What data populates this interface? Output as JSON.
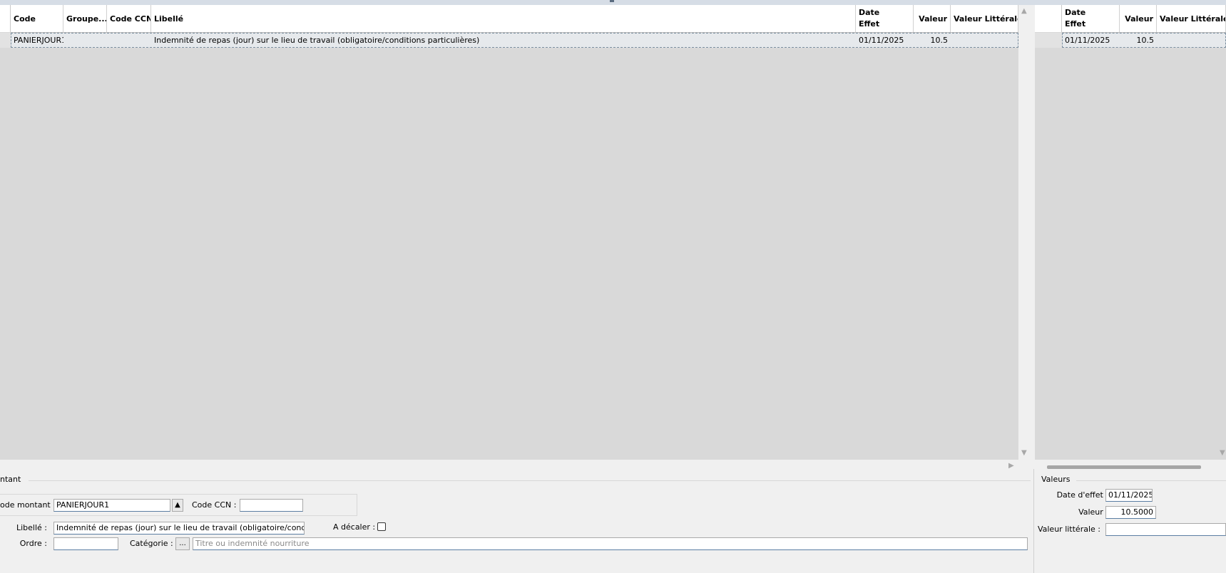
{
  "grid": {
    "columns": {
      "code": "Code",
      "groupe": "Groupe...",
      "code_ccn": "Code CCN",
      "libelle": "Libellé",
      "date_effet": "Date\nEffet",
      "valeur": "Valeur",
      "valeur_litterale": "Valeur Littérale"
    },
    "rows": [
      {
        "code": "PANIERJOUR1",
        "groupe": "",
        "code_ccn": "",
        "libelle": "Indemnité de repas (jour) sur le lieu de travail (obligatoire/conditions particulières)",
        "date_effet": "01/11/2025",
        "valeur": "10.5",
        "valeur_litterale": ""
      }
    ]
  },
  "values_grid": {
    "columns": {
      "date_effet": "Date\nEffet",
      "valeur": "Valeur",
      "valeur_litterale": "Valeur Littérale"
    },
    "rows": [
      {
        "date_effet": "01/11/2025",
        "valeur": "10.5",
        "valeur_litterale": ""
      }
    ]
  },
  "form": {
    "group_title": "ntant",
    "code_montant_label": "ode montant :",
    "code_montant_value": "PANIERJOUR1",
    "code_ccn_label": "Code CCN :",
    "code_ccn_value": "",
    "libelle_label": "Libellé :",
    "libelle_value": "Indemnité de repas (jour) sur le lieu de travail (obligatoire/conditions par",
    "a_decaler_label": "A décaler :",
    "ordre_label": "Ordre :",
    "ordre_value": "",
    "categorie_label": "Catégorie :",
    "categorie_button": "...",
    "categorie_placeholder": "Titre ou indemnité nourriture"
  },
  "values_form": {
    "group_title": "Valeurs",
    "date_effet_label": "Date d'effet :",
    "date_effet_value": "01/11/2025",
    "valeur_label": "Valeur :",
    "valeur_value": "10.5000",
    "valeur_litterale_label": "Valeur littérale :",
    "valeur_litterale_value": ""
  },
  "icons": {
    "spin_up": "triangle-up-icon",
    "scroll_up": "scroll-up-icon",
    "scroll_down": "scroll-down-icon",
    "scroll_right": "scroll-right-icon"
  },
  "colors": {
    "grid_background": "#d9d9d9",
    "selected_row_border": "#7c8fa0",
    "input_underline": "#5b7ea3"
  }
}
